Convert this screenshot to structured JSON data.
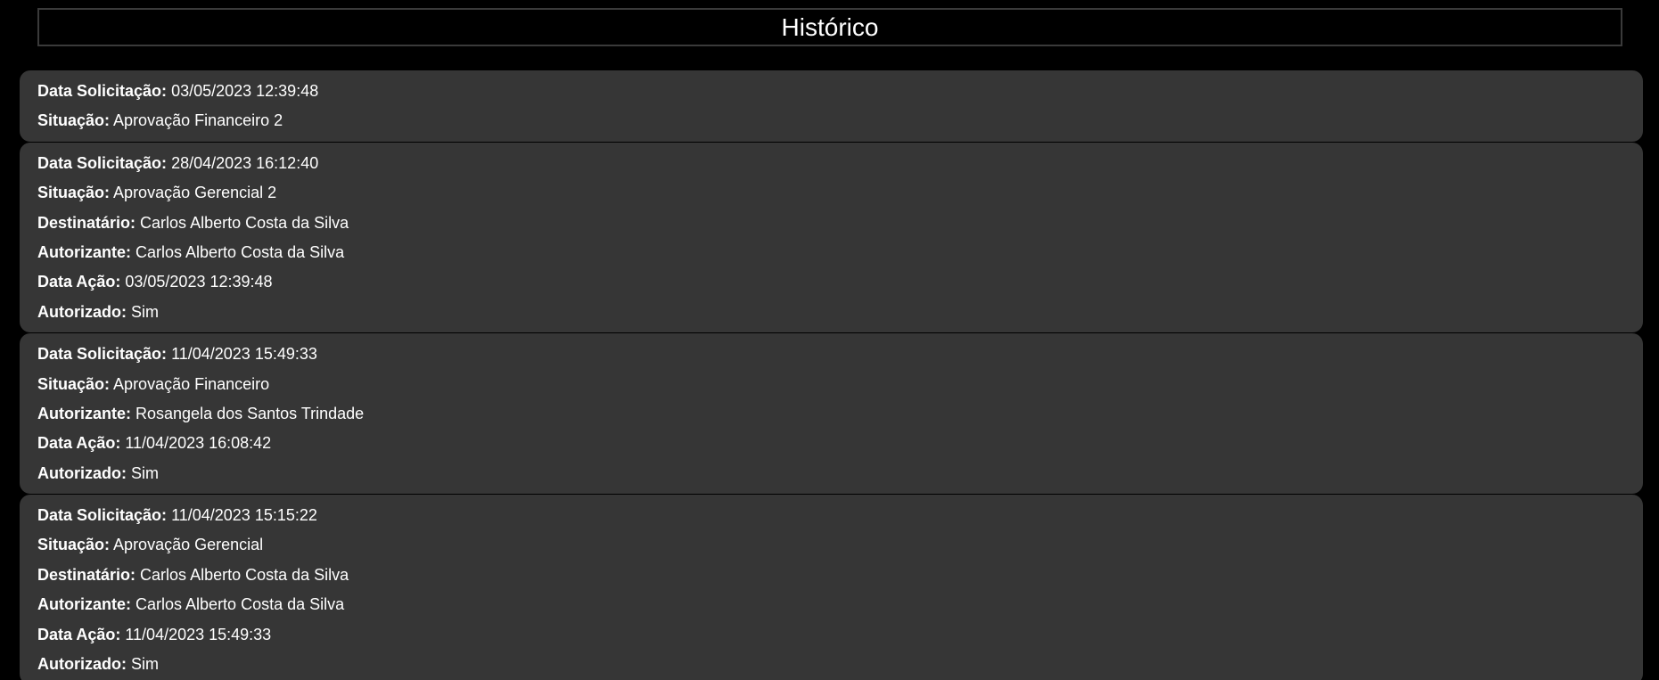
{
  "header": {
    "title": "Histórico"
  },
  "records": [
    {
      "fields": [
        {
          "label": "Data Solicitação:",
          "value": "03/05/2023 12:39:48"
        },
        {
          "label": "Situação:",
          "value": "Aprovação Financeiro 2"
        }
      ]
    },
    {
      "fields": [
        {
          "label": "Data Solicitação:",
          "value": "28/04/2023 16:12:40"
        },
        {
          "label": "Situação:",
          "value": "Aprovação Gerencial 2"
        },
        {
          "label": "Destinatário:",
          "value": "Carlos Alberto Costa da Silva"
        },
        {
          "label": "Autorizante:",
          "value": "Carlos Alberto Costa da Silva"
        },
        {
          "label": "Data Ação:",
          "value": "03/05/2023 12:39:48"
        },
        {
          "label": "Autorizado:",
          "value": "Sim"
        }
      ]
    },
    {
      "fields": [
        {
          "label": "Data Solicitação:",
          "value": "11/04/2023 15:49:33"
        },
        {
          "label": "Situação:",
          "value": "Aprovação Financeiro"
        },
        {
          "label": "Autorizante:",
          "value": "Rosangela dos Santos Trindade"
        },
        {
          "label": "Data Ação:",
          "value": "11/04/2023 16:08:42"
        },
        {
          "label": "Autorizado:",
          "value": "Sim"
        }
      ]
    },
    {
      "fields": [
        {
          "label": "Data Solicitação:",
          "value": "11/04/2023 15:15:22"
        },
        {
          "label": "Situação:",
          "value": "Aprovação Gerencial"
        },
        {
          "label": "Destinatário:",
          "value": "Carlos Alberto Costa da Silva"
        },
        {
          "label": "Autorizante:",
          "value": "Carlos Alberto Costa da Silva"
        },
        {
          "label": "Data Ação:",
          "value": "11/04/2023 15:49:33"
        },
        {
          "label": "Autorizado:",
          "value": "Sim"
        }
      ]
    }
  ]
}
